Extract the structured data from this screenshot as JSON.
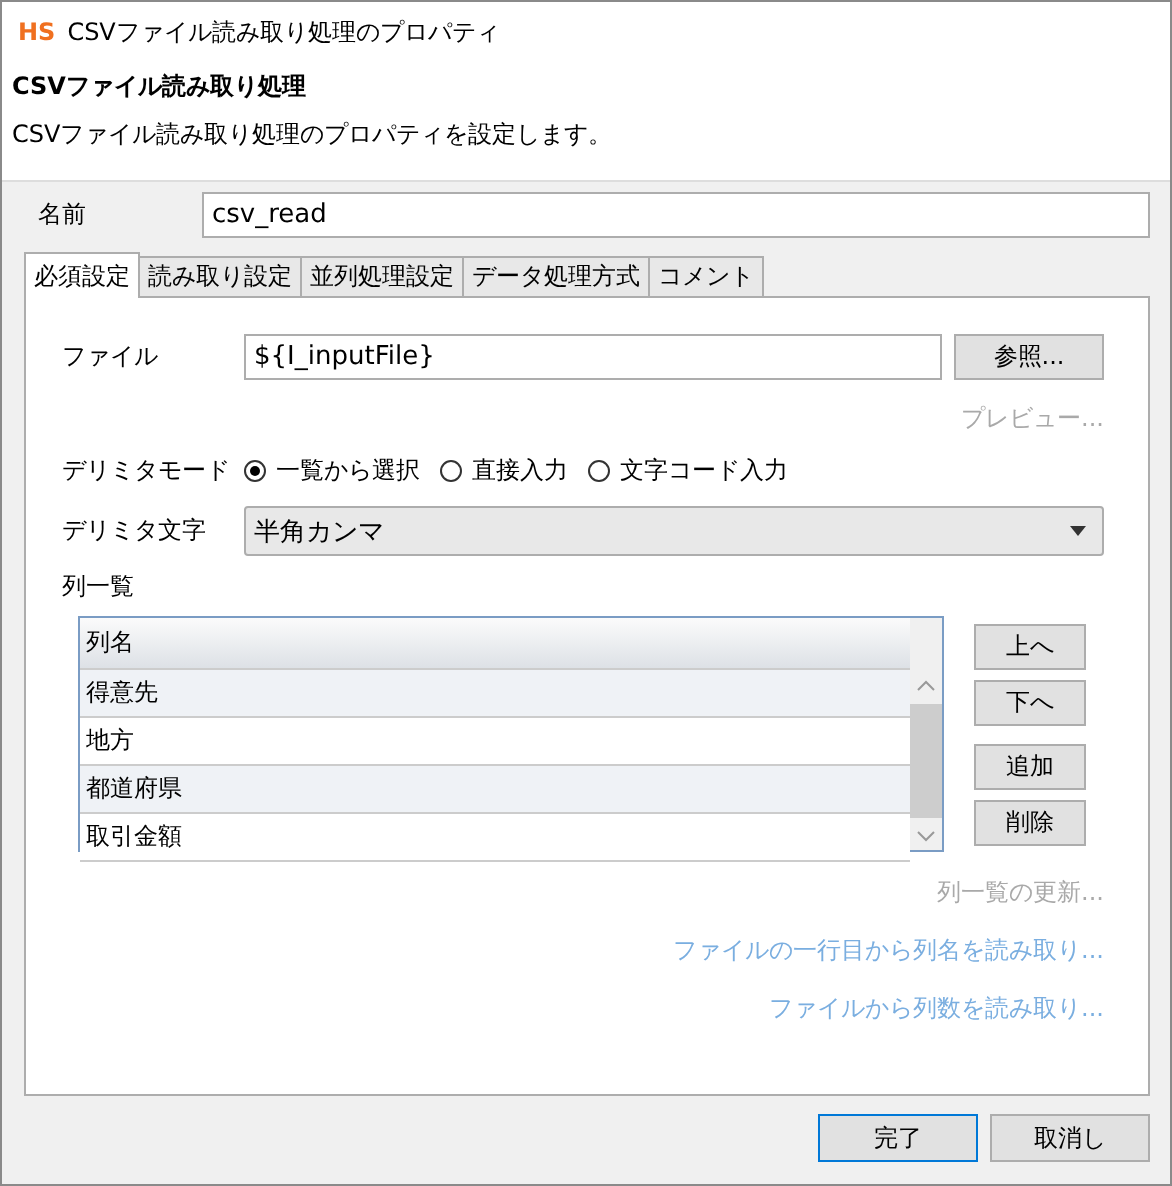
{
  "window": {
    "logo": "HS",
    "title": "CSVファイル読み取り処理のプロパティ"
  },
  "header": {
    "title": "CSVファイル読み取り処理",
    "description": "CSVファイル読み取り処理のプロパティを設定します。"
  },
  "name_field": {
    "label": "名前",
    "value": "csv_read"
  },
  "tabs": [
    {
      "label": "必須設定",
      "selected": true
    },
    {
      "label": "読み取り設定",
      "selected": false
    },
    {
      "label": "並列処理設定",
      "selected": false
    },
    {
      "label": "データ処理方式",
      "selected": false
    },
    {
      "label": "コメント",
      "selected": false
    }
  ],
  "file": {
    "label": "ファイル",
    "value": "${I_inputFile}",
    "button": "参照..."
  },
  "preview_link": {
    "label": "プレビュー...",
    "disabled": true
  },
  "delimiter_mode": {
    "label": "デリミタモード",
    "options": [
      {
        "label": "一覧から選択",
        "selected": true
      },
      {
        "label": "直接入力",
        "selected": false
      },
      {
        "label": "文字コード入力",
        "selected": false
      }
    ]
  },
  "delimiter_char": {
    "label": "デリミタ文字",
    "value": "半角カンマ"
  },
  "column_list": {
    "label": "列一覧",
    "header": "列名",
    "rows": [
      "得意先",
      "地方",
      "都道府県",
      "取引金額"
    ],
    "buttons": [
      "上へ",
      "下へ",
      "追加",
      "削除"
    ]
  },
  "links": [
    {
      "label": "列一覧の更新...",
      "disabled": true
    },
    {
      "label": "ファイルの一行目から列名を読み取り...",
      "disabled": false
    },
    {
      "label": "ファイルから列数を読み取り...",
      "disabled": false
    }
  ],
  "footer_buttons": [
    {
      "label": "完了",
      "default": true
    },
    {
      "label": "取消し",
      "default": false
    }
  ]
}
